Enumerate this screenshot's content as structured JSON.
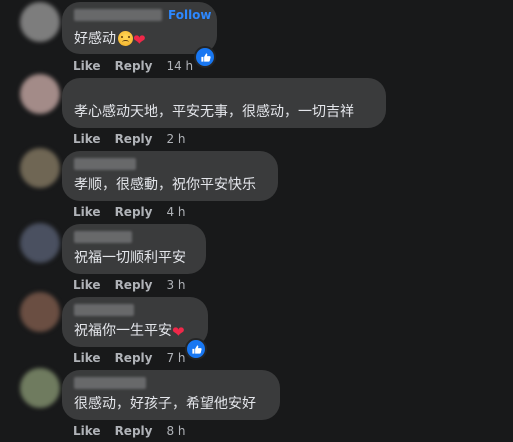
{
  "comments": [
    {
      "avatar_color": "#7d7d7d",
      "follow_label": "Follow",
      "text": "好感动",
      "emoji": [
        "sad-face-icon",
        "red-heart-icon"
      ],
      "like_label": "Like",
      "reply_label": "Reply",
      "time": "14 h",
      "has_reaction": true
    },
    {
      "avatar_color": "#a38b88",
      "text": "孝心感动天地，平安无事，很感动，一切吉祥",
      "like_label": "Like",
      "reply_label": "Reply",
      "time": "2 h",
      "has_reaction": false
    },
    {
      "avatar_color": "#6f6654",
      "text": "孝顺，很感動，祝你平安快乐",
      "like_label": "Like",
      "reply_label": "Reply",
      "time": "4 h",
      "has_reaction": false
    },
    {
      "avatar_color": "#4a5060",
      "text": "祝福一切顺利平安",
      "like_label": "Like",
      "reply_label": "Reply",
      "time": "3 h",
      "has_reaction": false
    },
    {
      "avatar_color": "#6a4e42",
      "text": "祝福你一生平安",
      "emoji": [
        "red-heart-icon"
      ],
      "like_label": "Like",
      "reply_label": "Reply",
      "time": "7 h",
      "has_reaction": true
    },
    {
      "avatar_color": "#6f7b5f",
      "text": "很感动，好孩子，希望他安好",
      "like_label": "Like",
      "reply_label": "Reply",
      "time": "8 h",
      "has_reaction": false
    }
  ]
}
